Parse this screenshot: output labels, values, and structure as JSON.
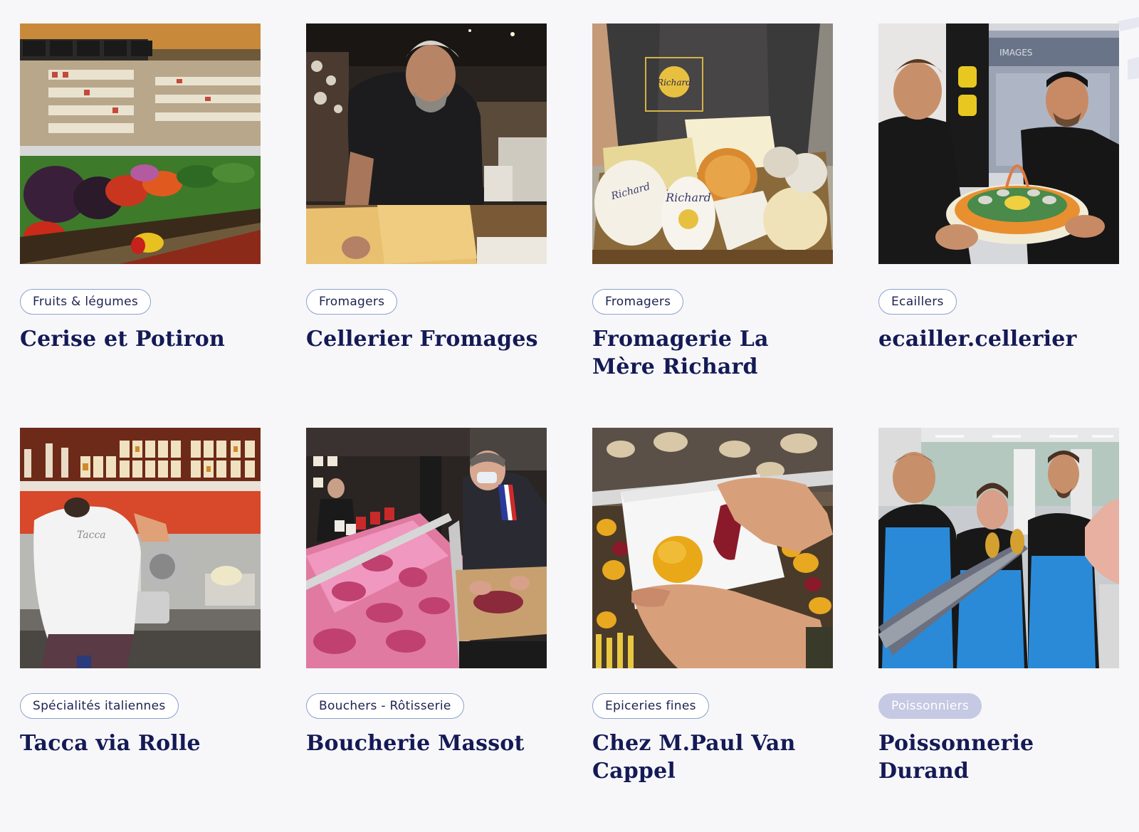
{
  "vendors": [
    {
      "category": "Fruits & légumes",
      "name": "Cerise et Potiron"
    },
    {
      "category": "Fromagers",
      "name": "Cellerier Fromages"
    },
    {
      "category": "Fromagers",
      "name": "Fromagerie La Mère Richard"
    },
    {
      "category": "Ecaillers",
      "name": "ecailler.cellerier"
    },
    {
      "category": "Spécialités italiennes",
      "name": "Tacca via Rolle"
    },
    {
      "category": "Bouchers - Rôtisserie",
      "name": "Boucherie Massot"
    },
    {
      "category": "Epiceries fines",
      "name": "Chez M.Paul Van Cappel"
    },
    {
      "category": "Poissonniers",
      "name": "Poissonnerie Durand"
    }
  ],
  "photo_texts": {
    "apron_logo": "Richard",
    "cheese_label_1": "Richard",
    "cheese_label_2": "Richard",
    "shop_sign": "IMAGES",
    "shirt_logo": "Tacca"
  },
  "colors": {
    "background": "#f7f7fa",
    "title": "#141a55",
    "tag_border": "#8aa3c9",
    "tag_text": "#1e2150",
    "tag_active_bg": "#c6c9e4"
  }
}
